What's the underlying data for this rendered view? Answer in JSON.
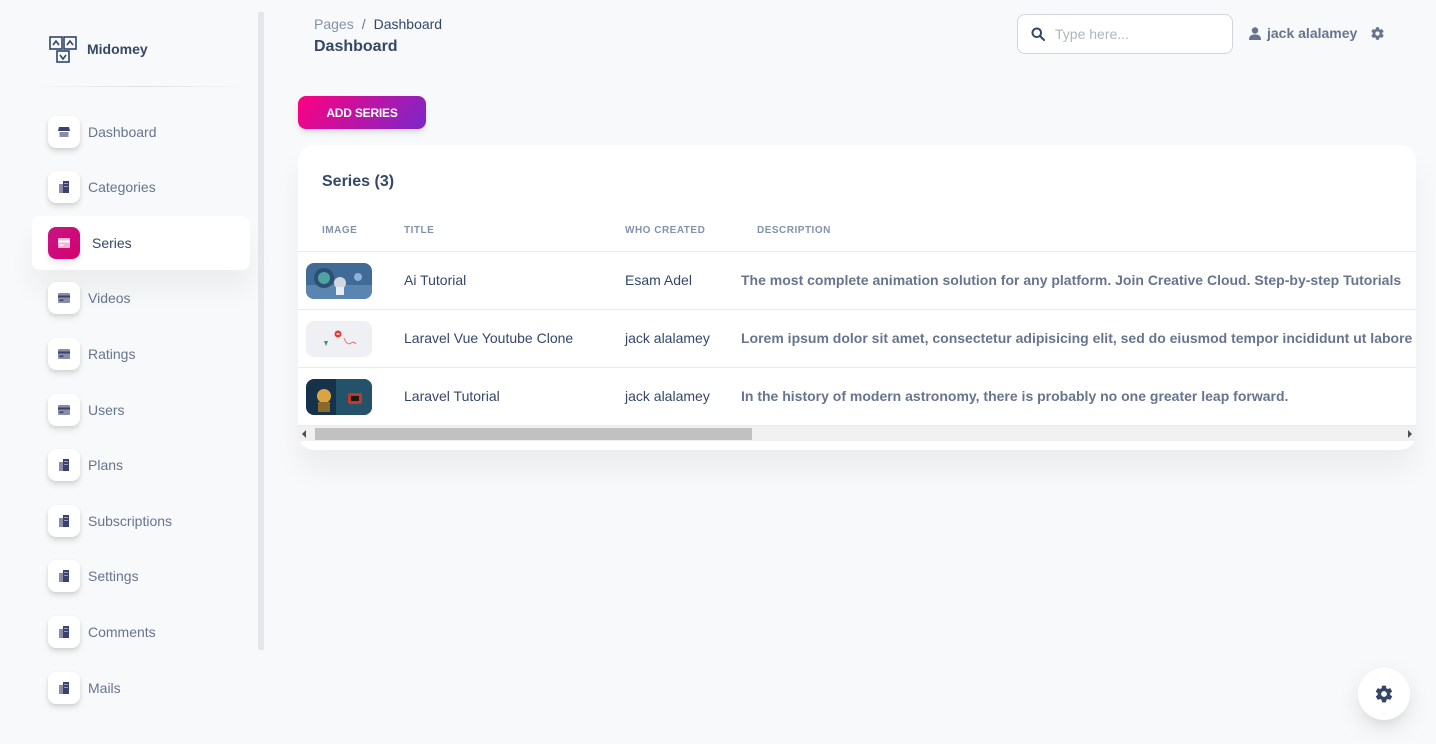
{
  "brand": {
    "name": "Midomey",
    "logo_icon": "midomey-logo-icon"
  },
  "sidebar": {
    "items": [
      {
        "label": "Dashboard",
        "icon": "shop-icon",
        "active": false
      },
      {
        "label": "Categories",
        "icon": "office-icon",
        "active": false
      },
      {
        "label": "Series",
        "icon": "credit-card-icon",
        "active": true
      },
      {
        "label": "Videos",
        "icon": "credit-card-icon",
        "active": false
      },
      {
        "label": "Ratings",
        "icon": "credit-card-icon",
        "active": false
      },
      {
        "label": "Users",
        "icon": "credit-card-icon",
        "active": false
      },
      {
        "label": "Plans",
        "icon": "office-icon",
        "active": false
      },
      {
        "label": "Subscriptions",
        "icon": "office-icon",
        "active": false
      },
      {
        "label": "Settings",
        "icon": "office-icon",
        "active": false
      },
      {
        "label": "Comments",
        "icon": "office-icon",
        "active": false
      },
      {
        "label": "Mails",
        "icon": "office-icon",
        "active": false
      }
    ]
  },
  "header": {
    "breadcrumb": {
      "parent": "Pages",
      "separator": "/",
      "current": "Dashboard"
    },
    "title": "Dashboard",
    "search": {
      "placeholder": "Type here...",
      "value": ""
    },
    "user": {
      "name": "jack alalamey"
    }
  },
  "toolbar": {
    "add_label": "ADD SERIES"
  },
  "series_card": {
    "title": "Series (3)",
    "columns": [
      "Image",
      "Title",
      "Who Created",
      "Description"
    ],
    "rows": [
      {
        "title": "Ai Tutorial",
        "author": "Esam Adel",
        "description": "The most complete animation solution for any platform. Join Creative Cloud. Step-by-step Tutorials"
      },
      {
        "title": "Laravel Vue Youtube Clone",
        "author": "jack alalamey",
        "description": "Lorem ipsum dolor sit amet, consectetur adipisicing elit, sed do eiusmod tempor incididunt ut labore"
      },
      {
        "title": "Laravel Tutorial",
        "author": "jack alalamey",
        "description": "In the history of modern astronomy, there is probably no one greater leap forward."
      }
    ]
  },
  "colors": {
    "accent": "#d6006f",
    "button_gradient_start": "#7928ca",
    "button_gradient_end": "#ff0080",
    "text_primary": "#344767",
    "text_secondary": "#67748e"
  }
}
